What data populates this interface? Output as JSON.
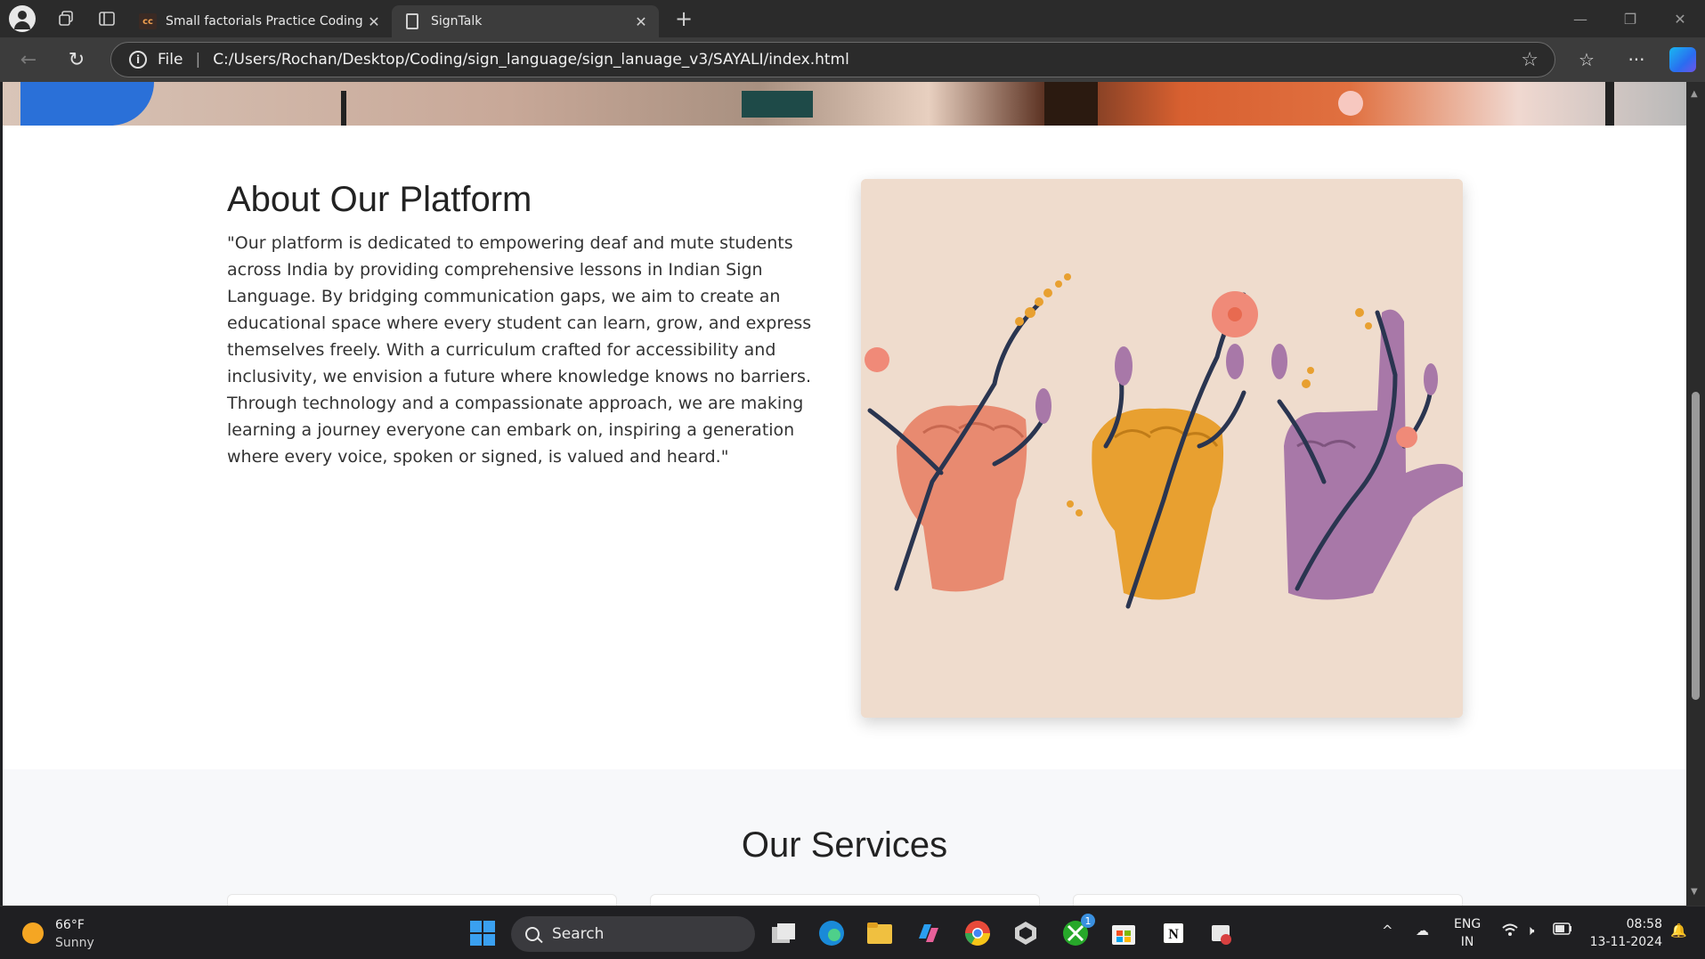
{
  "browser": {
    "tabs": [
      {
        "favicon": "cc",
        "title": "Small factorials Practice Coding P",
        "active": false
      },
      {
        "favicon": "doc-icon",
        "title": "SignTalk",
        "active": true
      }
    ],
    "new_tab_symbol": "+",
    "address": {
      "scheme_label": "File",
      "url": "C:/Users/Rochan/Desktop/Coding/sign_language/sign_lanuage_v3/SAYALI/index.html"
    }
  },
  "page": {
    "about": {
      "title": "About Our Platform",
      "text": "\"Our platform is dedicated to empowering deaf and mute students across India by providing comprehensive lessons in Indian Sign Language. By bridging communication gaps, we aim to create an educational space where every student can learn, grow, and express themselves freely. With a curriculum crafted for accessibility and inclusivity, we envision a future where knowledge knows no barriers. Through technology and a compassionate approach, we are making learning a journey everyone can embark on, inspiring a generation where every voice, spoken or signed, is valued and heard.\""
    },
    "services": {
      "title": "Our Services"
    },
    "colors": {
      "art_background": "#efdccd",
      "hand_pink": "#e88a70",
      "hand_orange": "#e8a030",
      "hand_purple": "#a878a8",
      "vine": "#2a3550"
    }
  },
  "taskbar": {
    "weather": {
      "temp": "66°F",
      "condition": "Sunny"
    },
    "search_placeholder": "Search",
    "xbox_badge": "1",
    "language": {
      "line1": "ENG",
      "line2": "IN"
    },
    "clock": {
      "time": "08:58",
      "date": "13-11-2024"
    }
  }
}
